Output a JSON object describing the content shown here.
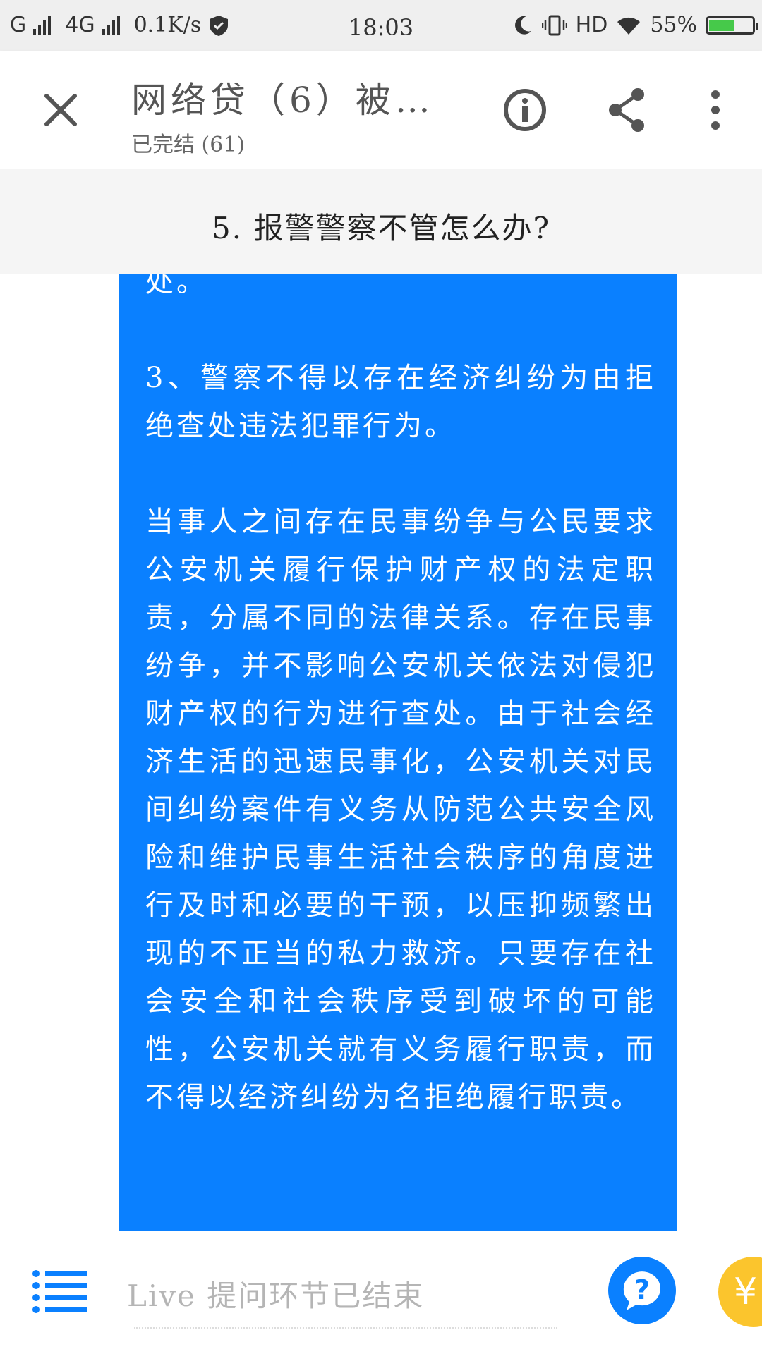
{
  "status_bar": {
    "carrier1": "G",
    "carrier2": "4G",
    "speed": "0.1K/s",
    "time": "18:03",
    "hd": "HD",
    "battery": "55%"
  },
  "header": {
    "title": "网络贷（6）被…",
    "subtitle": "已完结 (61)"
  },
  "section": {
    "title": "5. 报警警察不管怎么办?"
  },
  "content": {
    "paragraphs": [
      "处。",
      "3、警察不得以存在经济纠纷为由拒绝查处违法犯罪行为。",
      "当事人之间存在民事纷争与公民要求公安机关履行保护财产权的法定职责，分属不同的法律关系。存在民事纷争，并不影响公安机关依法对侵犯财产权的行为进行查处。由于社会经济生活的迅速民事化，公安机关对民间纠纷案件有义务从防范公共安全风险和维护民事生活社会秩序的角度进行及时和必要的干预，以压抑频繁出现的不正当的私力救济。只要存在社会安全和社会秩序受到破坏的可能性，公安机关就有义务履行职责，而不得以经济纠纷为名拒绝履行职责。"
    ]
  },
  "bottom_bar": {
    "input_hint": "Live 提问环节已结束",
    "coin_symbol": "¥"
  },
  "colors": {
    "accent_blue": "#0a80ff",
    "coin_yellow": "#fbc52d"
  },
  "icons": [
    "close-icon",
    "info-icon",
    "share-icon",
    "more-icon",
    "menu-list-icon",
    "question-icon",
    "coin-icon"
  ]
}
